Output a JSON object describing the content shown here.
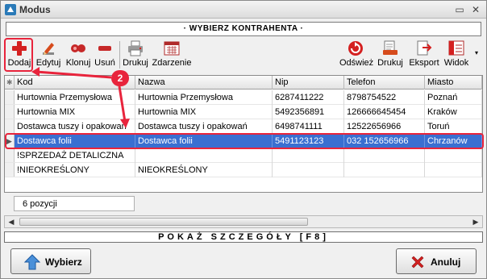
{
  "window": {
    "title": "Modus",
    "minimize_glyph": "▭",
    "close_glyph": "✕"
  },
  "header": {
    "title": "· WYBIERZ KONTRAHENTA ·"
  },
  "toolbar": {
    "left": [
      {
        "label": "Dodaj",
        "icon": "plus-icon"
      },
      {
        "label": "Edytuj",
        "icon": "pencil-icon"
      },
      {
        "label": "Klonuj",
        "icon": "clone-icon"
      },
      {
        "label": "Usuń",
        "icon": "minus-icon"
      },
      {
        "label": "Drukuj",
        "icon": "printer-icon"
      },
      {
        "label": "Zdarzenie",
        "icon": "calendar-icon"
      }
    ],
    "right": [
      {
        "label": "Odśwież",
        "icon": "refresh-icon"
      },
      {
        "label": "Drukuj",
        "icon": "print-document-icon"
      },
      {
        "label": "Eksport",
        "icon": "export-icon"
      },
      {
        "label": "Widok",
        "icon": "view-icon"
      }
    ]
  },
  "table": {
    "columns": [
      "Kod",
      "Nazwa",
      "Nip",
      "Telefon",
      "Miasto"
    ],
    "rows": [
      [
        "Hurtownia Przemysłowa",
        "Hurtownia Przemysłowa",
        "6287411222",
        "8798754522",
        "Poznań"
      ],
      [
        "Hurtownia MIX",
        "Hurtownia MIX",
        "5492356891",
        "126666645454",
        "Kraków"
      ],
      [
        "Dostawca tuszy i opakowań",
        "Dostawca tuszy i opakowań",
        "6498741111",
        "12522656966",
        "Toruń"
      ],
      [
        "Dostawca folii",
        "Dostawca folii",
        "5491123123",
        "032 152656966",
        "Chrzanów"
      ],
      [
        "!SPRZEDAŻ DETALICZNA",
        "",
        "",
        "",
        ""
      ],
      [
        "!NIEOKREŚLONY",
        "NIEOKREŚLONY",
        "",
        "",
        ""
      ]
    ],
    "selected_row": 3
  },
  "status": {
    "count": "6 pozycji"
  },
  "details": {
    "label": "POKAŻ SZCZEGÓŁY [F8]"
  },
  "buttons": {
    "select": "Wybierz",
    "cancel": "Anuluj"
  },
  "annotation": {
    "step": "2"
  },
  "colors": {
    "highlight": "#e8243c",
    "selection": "#3a6fd1"
  }
}
